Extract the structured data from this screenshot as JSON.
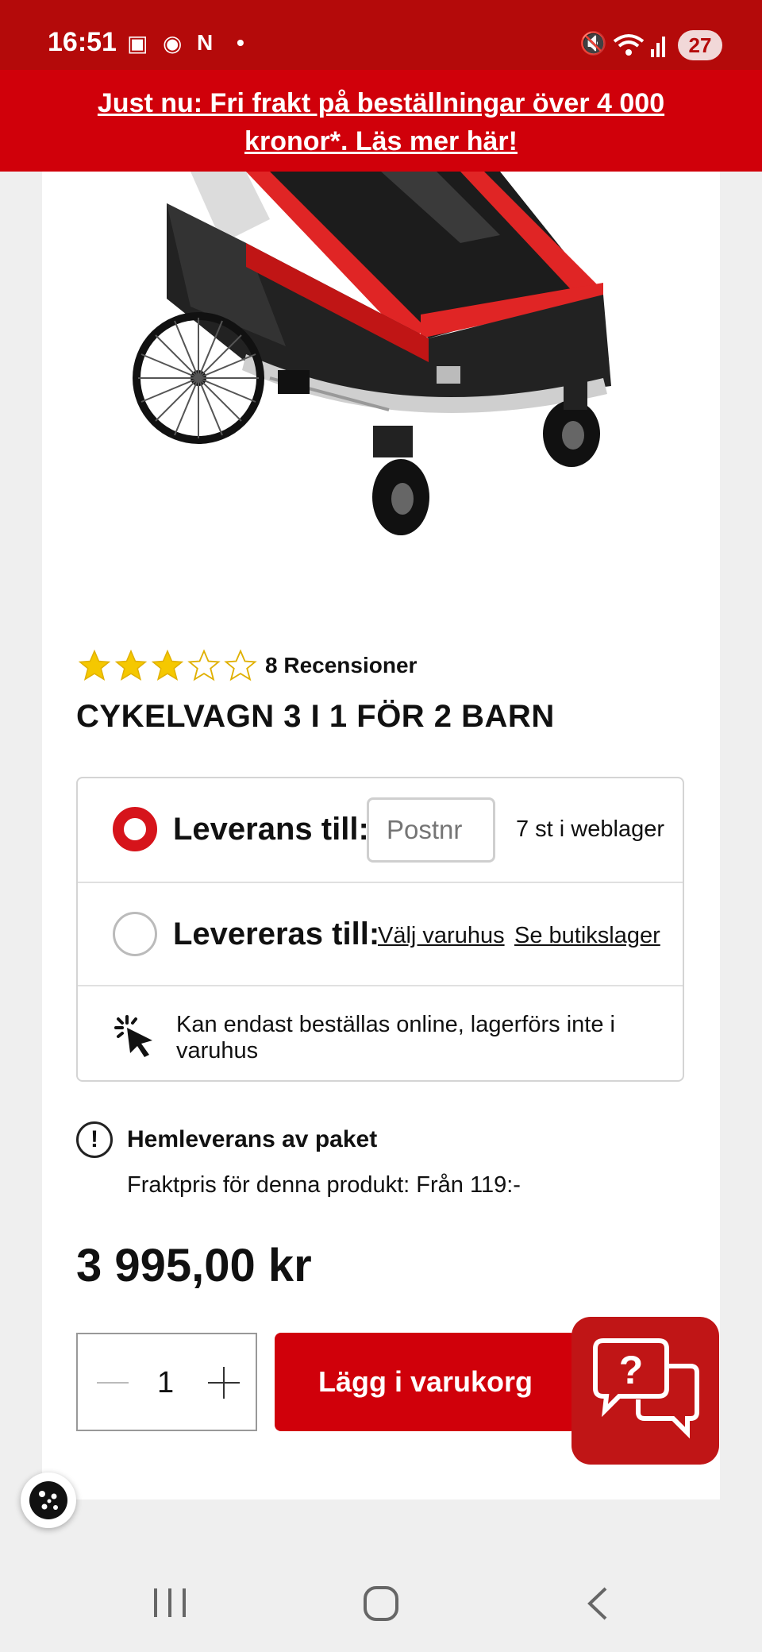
{
  "status_bar": {
    "time": "16:51",
    "notification_count": "27"
  },
  "banner": {
    "text": "Just nu: Fri frakt på beställningar över 4 000 kronor*. Läs mer här!"
  },
  "product": {
    "rating": 3,
    "rating_max": 5,
    "reviews_label": "8 Recensioner",
    "title": "CYKELVAGN 3 I 1 FÖR 2 BARN"
  },
  "delivery": {
    "home_label": "Leverans till:",
    "postnr_placeholder": "Postnr",
    "stock_text": "7 st i weblager",
    "store_label": "Levereras till:",
    "choose_store": "Välj varuhus",
    "store_stock": "Se butikslager",
    "online_note": "Kan endast beställas online, lagerförs inte i varuhus"
  },
  "shipping": {
    "title": "Hemleverans av paket",
    "text": "Fraktpris för denna produkt: Från 119:-"
  },
  "price": "3 995,00 kr",
  "cart": {
    "quantity": "1",
    "add_label": "Lägg i varukorg"
  },
  "colors": {
    "brand_red": "#d0000a",
    "status_red": "#b40a0a",
    "star_yellow": "#f5c800"
  }
}
